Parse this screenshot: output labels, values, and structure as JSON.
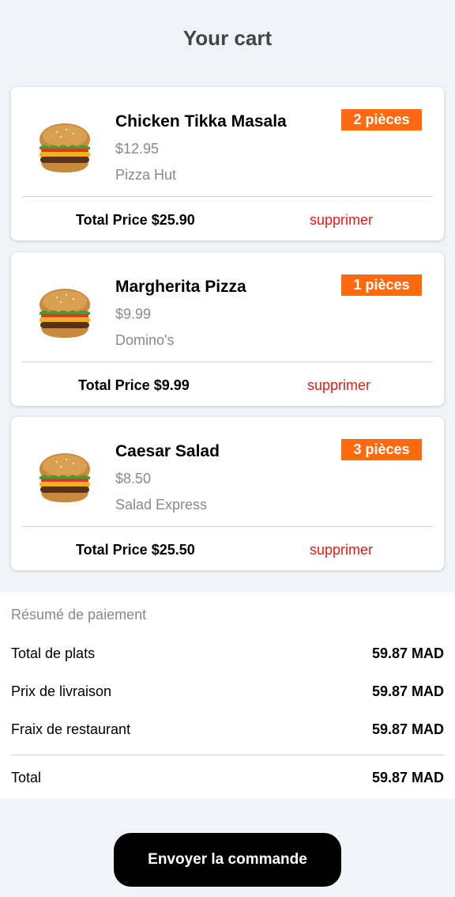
{
  "header": {
    "title": "Your cart"
  },
  "cart": {
    "items": [
      {
        "name": "Chicken Tikka Masala",
        "price": "$12.95",
        "restaurant": "Pizza Hut",
        "quantity_label": "2 pièces",
        "total_label": "Total Price $25.90",
        "delete_label": "supprimer",
        "image_icon": "burger-icon"
      },
      {
        "name": "Margherita Pizza",
        "price": "$9.99",
        "restaurant": "Domino's",
        "quantity_label": "1 pièces",
        "total_label": "Total Price $9.99",
        "delete_label": "supprimer",
        "image_icon": "burger-icon"
      },
      {
        "name": "Caesar Salad",
        "price": "$8.50",
        "restaurant": "Salad Express",
        "quantity_label": "3 pièces",
        "total_label": "Total Price $25.50",
        "delete_label": "supprimer",
        "image_icon": "burger-icon"
      }
    ]
  },
  "summary": {
    "title": "Résumé de paiement",
    "rows": [
      {
        "label": "Total de plats",
        "value": "59.87 MAD"
      },
      {
        "label": "Prix de livraison",
        "value": "59.87 MAD"
      },
      {
        "label": "Fraix de restaurant",
        "value": "59.87 MAD"
      }
    ],
    "total": {
      "label": "Total",
      "value": "59.87 MAD"
    }
  },
  "actions": {
    "submit_label": "Envoyer la commande"
  },
  "colors": {
    "accent": "#ff6a10",
    "danger": "#e31b14",
    "background": "#f1f3fa",
    "button": "#000000"
  }
}
